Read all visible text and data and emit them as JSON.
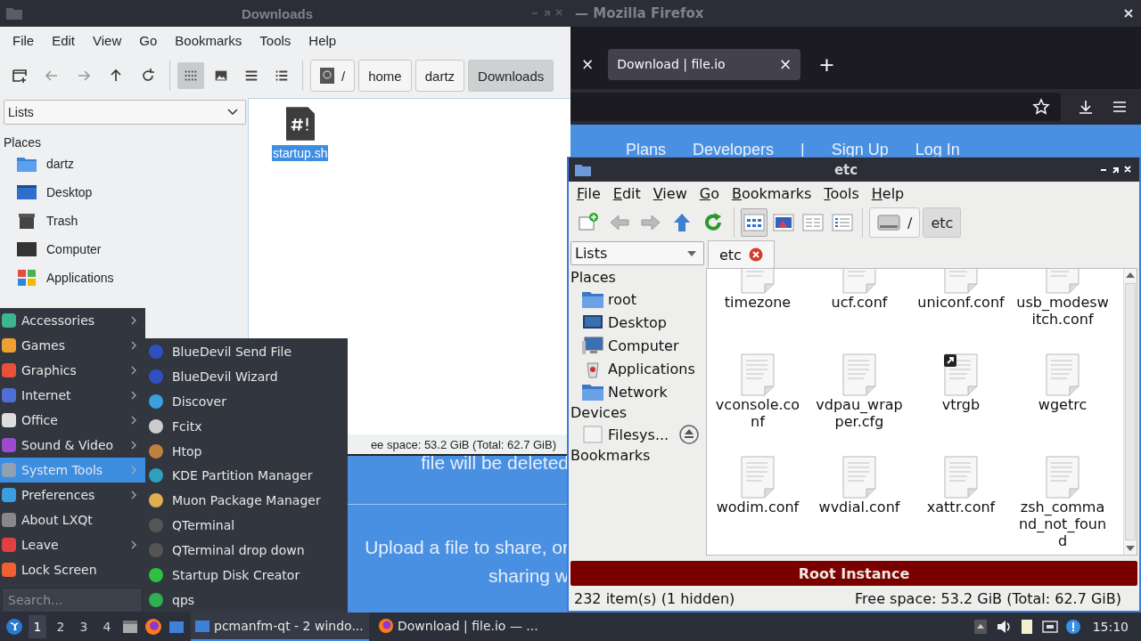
{
  "browser": {
    "title": "— Mozilla Firefox",
    "tabs": [
      {
        "label": "Download | file.io",
        "selected": true
      }
    ],
    "tab_close": "×",
    "new_tab": "+",
    "nav_links": [
      "Plans",
      "Developers",
      "|",
      "Sign Up",
      "Log In"
    ],
    "page_texts": [
      "file will be deleted",
      "Upload a file to share, or",
      "sharing w"
    ]
  },
  "downloads_window": {
    "title": "Downloads",
    "menu": [
      "File",
      "Edit",
      "View",
      "Go",
      "Bookmarks",
      "Tools",
      "Help"
    ],
    "view_modes": [
      {
        "kind": "icons",
        "selected": true
      },
      {
        "kind": "thumbnails",
        "selected": false
      },
      {
        "kind": "compact",
        "selected": false
      },
      {
        "kind": "details",
        "selected": false
      }
    ],
    "path": [
      {
        "label": "/",
        "kind": "root",
        "selected": false
      },
      {
        "label": "home",
        "kind": "dir",
        "selected": false
      },
      {
        "label": "dartz",
        "kind": "dir",
        "selected": false
      },
      {
        "label": "Downloads",
        "kind": "dir",
        "selected": true
      }
    ],
    "dropdown": "Lists",
    "section": "Places",
    "places": [
      {
        "label": "dartz",
        "kind": "home"
      },
      {
        "label": "Desktop",
        "kind": "desktop"
      },
      {
        "label": "Trash",
        "kind": "trash"
      },
      {
        "label": "Computer",
        "kind": "computer"
      },
      {
        "label": "Applications",
        "kind": "apps"
      }
    ],
    "files": [
      {
        "name": "startup.sh",
        "selected": true
      }
    ],
    "status": "ee space: 53.2 GiB (Total: 62.7 GiB)"
  },
  "etc_window": {
    "title": "etc",
    "menu": [
      "File",
      "Edit",
      "View",
      "Go",
      "Bookmarks",
      "Tools",
      "Help"
    ],
    "view_modes": [
      {
        "kind": "icons",
        "selected": true
      },
      {
        "kind": "thumbnails",
        "selected": false
      },
      {
        "kind": "compact",
        "selected": false
      },
      {
        "kind": "details",
        "selected": false
      }
    ],
    "path": [
      {
        "label": "/",
        "kind": "root",
        "selected": false
      },
      {
        "label": "etc",
        "kind": "dir",
        "selected": true
      }
    ],
    "dropdown": "Lists",
    "tabs": [
      {
        "label": "etc",
        "selected": true
      }
    ],
    "sections": [
      {
        "title": "Places",
        "items": [
          {
            "label": "root",
            "kind": "folder"
          },
          {
            "label": "Desktop",
            "kind": "desktop"
          },
          {
            "label": "Computer",
            "kind": "computer"
          },
          {
            "label": "Applications",
            "kind": "apps"
          },
          {
            "label": "Network",
            "kind": "folder"
          }
        ]
      },
      {
        "title": "Devices",
        "items": [
          {
            "label": "Filesys...",
            "kind": "drive"
          }
        ]
      },
      {
        "title": "Bookmarks"
      }
    ],
    "files": [
      {
        "name": "timezone"
      },
      {
        "name": "ucf.conf"
      },
      {
        "name": "uniconf.conf"
      },
      {
        "name": "usb_modeswitch.conf"
      },
      {
        "name": "vconsole.conf",
        "link": false
      },
      {
        "name": "vdpau_wrapper.cfg",
        "link": false
      },
      {
        "name": "vtrgb",
        "link": true
      },
      {
        "name": "wgetrc",
        "link": false
      },
      {
        "name": "wodim.conf",
        "link": false
      },
      {
        "name": "wvdial.conf",
        "link": false
      },
      {
        "name": "xattr.conf",
        "link": false
      },
      {
        "name": "zsh_command_not_found",
        "link": false
      }
    ],
    "banner": "Root Instance",
    "status_left": "232 item(s) (1 hidden)",
    "status_right": "Free space: 53.2 GiB (Total: 62.7 GiB)"
  },
  "app_menu": {
    "items": [
      {
        "label": "Accessories",
        "submenu": true,
        "selected": false
      },
      {
        "label": "Games",
        "submenu": true,
        "selected": false
      },
      {
        "label": "Graphics",
        "submenu": true,
        "selected": false
      },
      {
        "label": "Internet",
        "submenu": true,
        "selected": false
      },
      {
        "label": "Office",
        "submenu": true,
        "selected": false
      },
      {
        "label": "Sound & Video",
        "submenu": true,
        "selected": false
      },
      {
        "label": "System Tools",
        "submenu": true,
        "selected": true
      },
      {
        "label": "Preferences",
        "submenu": true,
        "selected": false
      },
      {
        "label": "About LXQt",
        "submenu": false,
        "selected": false
      },
      {
        "label": "Leave",
        "submenu": true,
        "selected": false
      },
      {
        "label": "Lock Screen",
        "submenu": false,
        "selected": false
      }
    ],
    "search": {
      "placeholder": "Search..."
    },
    "submenu": [
      "BlueDevil Send File",
      "BlueDevil Wizard",
      "Discover",
      "Fcitx",
      "Htop",
      "KDE Partition Manager",
      "Muon Package Manager",
      "QTerminal",
      "QTerminal drop down",
      "Startup Disk Creator",
      "qps"
    ]
  },
  "taskbar": {
    "desktops": [
      {
        "label": "1",
        "selected": true
      },
      {
        "label": "2",
        "selected": false
      },
      {
        "label": "3",
        "selected": false
      },
      {
        "label": "4",
        "selected": false
      }
    ],
    "tasks": [
      {
        "label": "pcmanfm-qt - 2 windo...",
        "kind": "files",
        "selected": true
      },
      {
        "label": "Download | file.io — ...",
        "kind": "browser",
        "selected": false
      }
    ],
    "clock": "15:10"
  }
}
